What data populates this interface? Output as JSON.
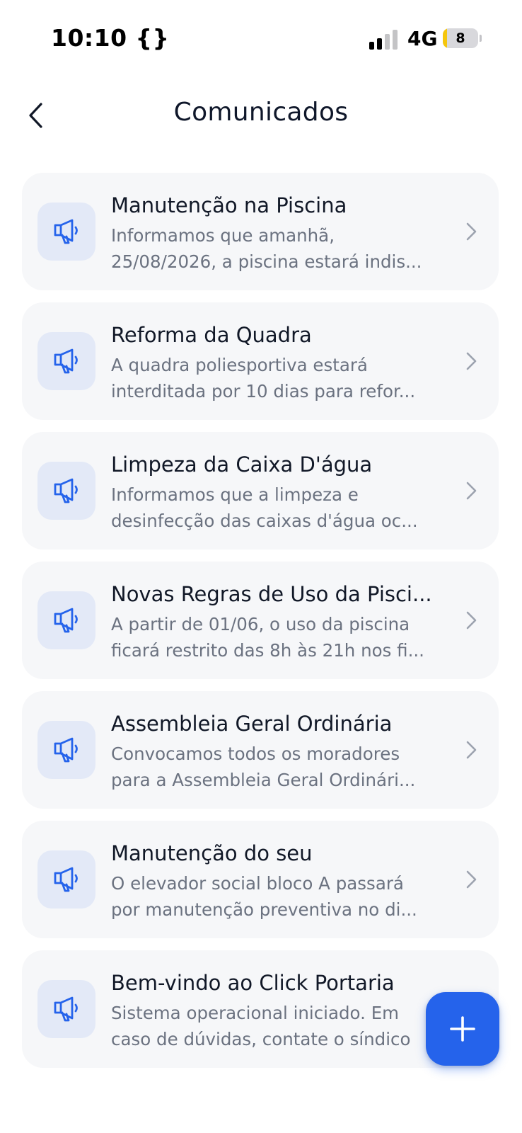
{
  "status_bar": {
    "time": "10:10 {}",
    "network": "4G",
    "battery_level": "8",
    "battery_fraction": 0.12,
    "signal_bars_active": 2,
    "signal_bars_total": 4
  },
  "header": {
    "title": "Comunicados",
    "back_icon": "chevron-left-icon"
  },
  "colors": {
    "accent": "#2563eb",
    "icon_tile_bg": "#e3e9f7",
    "card_bg": "#f6f7f9",
    "battery_low": "#f5c60c"
  },
  "announcements": [
    {
      "title": "Manutenção na Piscina",
      "desc_line1": "Informamos que amanhã,",
      "desc_line2": "25/08/2026, a piscina estará indis..."
    },
    {
      "title": "Reforma da Quadra",
      "desc_line1": "A quadra poliesportiva estará",
      "desc_line2": "interditada por 10 dias para refor..."
    },
    {
      "title": "Limpeza da Caixa D'água",
      "desc_line1": "Informamos que a limpeza e",
      "desc_line2": "desinfecção das caixas d'água oc..."
    },
    {
      "title": "Novas Regras de Uso da Pisci...",
      "desc_line1": "A partir de 01/06, o uso da piscina",
      "desc_line2": "ficará restrito das 8h às 21h nos fi..."
    },
    {
      "title": "Assembleia Geral Ordinária",
      "desc_line1": "Convocamos todos os moradores",
      "desc_line2": "para a Assembleia Geral Ordinári..."
    },
    {
      "title": "Manutenção do seu",
      "desc_line1": "O elevador social bloco A passará",
      "desc_line2": "por manutenção preventiva no di..."
    },
    {
      "title": "Bem-vindo ao Click Portaria",
      "desc_line1": "Sistema operacional iniciado. Em",
      "desc_line2": "caso de dúvidas, contate o síndico"
    }
  ],
  "fab": {
    "icon": "plus-icon"
  }
}
